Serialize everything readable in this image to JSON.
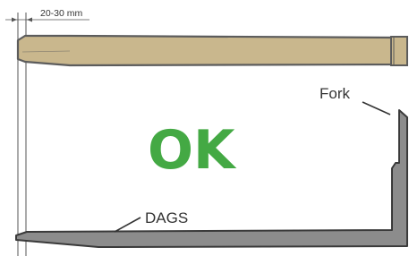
{
  "dimension": {
    "label": "20-30 mm"
  },
  "labels": {
    "top": "Fork",
    "bottom": "DAGS"
  },
  "status": {
    "text": "OK",
    "color": "#44a944"
  },
  "colors": {
    "top_fill": "#c9b78d",
    "top_outline": "#5c5c5c",
    "bottom_fill": "#8c8c8c",
    "bottom_outline": "#3a3a3a",
    "guide": "#555555"
  }
}
